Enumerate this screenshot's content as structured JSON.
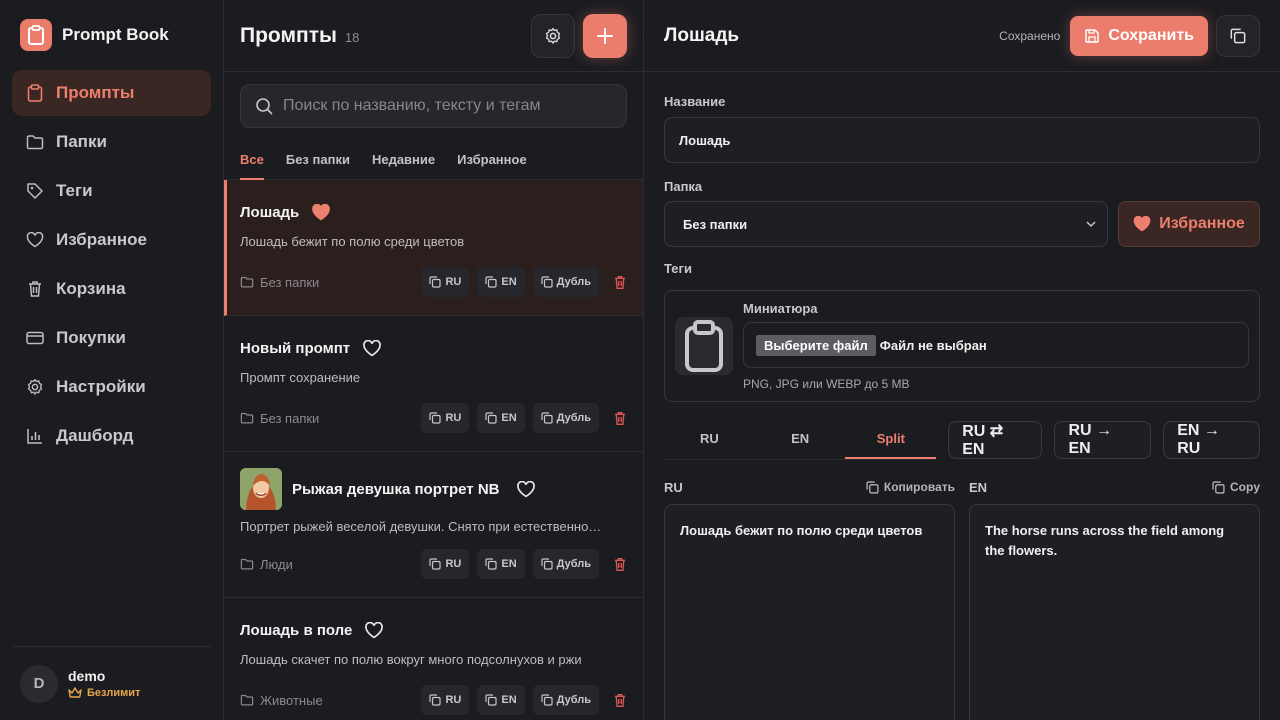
{
  "brand": {
    "name": "Prompt Book"
  },
  "nav": {
    "items": [
      {
        "label": "Промпты",
        "icon": "clipboard-icon",
        "active": true
      },
      {
        "label": "Папки",
        "icon": "folder-icon"
      },
      {
        "label": "Теги",
        "icon": "tag-icon"
      },
      {
        "label": "Избранное",
        "icon": "heart-icon"
      },
      {
        "label": "Корзина",
        "icon": "trash-icon"
      },
      {
        "label": "Покупки",
        "icon": "credit-card-icon"
      },
      {
        "label": "Настройки",
        "icon": "gear-icon"
      },
      {
        "label": "Дашборд",
        "icon": "bar-chart-icon"
      }
    ]
  },
  "user": {
    "initial": "D",
    "name": "demo",
    "plan": "Безлимит"
  },
  "list": {
    "title": "Промпты",
    "count": "18",
    "search_placeholder": "Поиск по названию, тексту и тегам",
    "tabs": [
      "Все",
      "Без папки",
      "Недавние",
      "Избранное"
    ],
    "cards": [
      {
        "title": "Лошадь",
        "desc": "Лошадь бежит по полю среди цветов",
        "folder": "Без папки",
        "favorite": true,
        "active": true
      },
      {
        "title": "Новый промпт",
        "desc": "Промпт сохранение",
        "folder": "Без папки",
        "favorite": false
      },
      {
        "title": "Рыжая девушка портрет NB",
        "desc": "Портрет рыжей веселой девушки. Снято при естественно…",
        "folder": "Люди",
        "favorite": false,
        "has_thumb": true
      },
      {
        "title": "Лошадь в поле",
        "desc": "Лошадь скачет по полю вокруг много подсолнухов и ржи",
        "folder": "Животные",
        "favorite": false
      }
    ],
    "chip_ru": "RU",
    "chip_en": "EN",
    "chip_dup": "Дубль"
  },
  "editor": {
    "title": "Лошадь",
    "saved_status": "Сохранено",
    "save_label": "Сохранить",
    "name_label": "Название",
    "name_value": "Лошадь",
    "folder_label": "Папка",
    "folder_value": "Без папки",
    "favorite_label": "Избранное",
    "tags_label": "Теги",
    "thumb_label": "Миниатюра",
    "file_button": "Выберите файл",
    "file_name": "Файл не выбран",
    "thumb_hint": "PNG, JPG или WEBP до 5 MB",
    "lang_tabs": [
      "RU",
      "EN",
      "Split"
    ],
    "active_lang_tab": "Split",
    "translate_buttons": [
      "RU ⇄ EN",
      "RU → EN",
      "EN → RU"
    ],
    "ru_label": "RU",
    "ru_copy": "Копировать",
    "ru_text": "Лошадь бежит по полю среди цветов",
    "en_label": "EN",
    "en_copy": "Copy",
    "en_text": "The horse runs across the field among the flowers."
  },
  "colors": {
    "accent": "#ec7c6c",
    "background": "#1b1c20",
    "gold": "#e7a64b",
    "danger": "#e05555"
  }
}
